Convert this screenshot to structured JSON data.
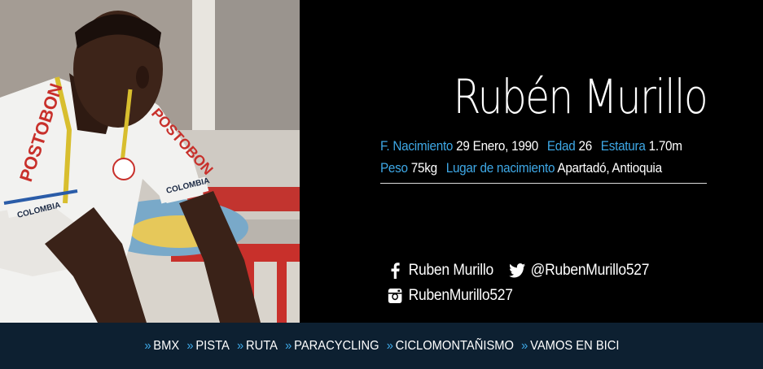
{
  "profile": {
    "name": "Rubén Murillo",
    "facts": [
      {
        "label": "F. Nacimiento",
        "value": "29 Enero, 1990"
      },
      {
        "label": "Edad",
        "value": "26"
      },
      {
        "label": "Estatura",
        "value": "1.70m"
      },
      {
        "label": "Peso",
        "value": "75kg"
      },
      {
        "label": "Lugar de nacimiento",
        "value": "Apartadó, Antioquia"
      }
    ]
  },
  "photo": {
    "jersey_text": [
      "POSTOBON",
      "POSTOBON",
      "COLOMBIA",
      "COLOMBIA"
    ]
  },
  "social": {
    "facebook": "Ruben Murillo",
    "twitter": "@RubenMurillo527",
    "instagram": "RubenMurillo527"
  },
  "nav": {
    "chevron": "»",
    "items": [
      "BMX",
      "PISTA",
      "RUTA",
      "PARACYCLING",
      "CICLOMONTAÑISMO",
      "VAMOS EN BICI"
    ]
  },
  "colors": {
    "accent": "#3ea8e6",
    "navbar": "#0d2031",
    "background": "#000000"
  }
}
